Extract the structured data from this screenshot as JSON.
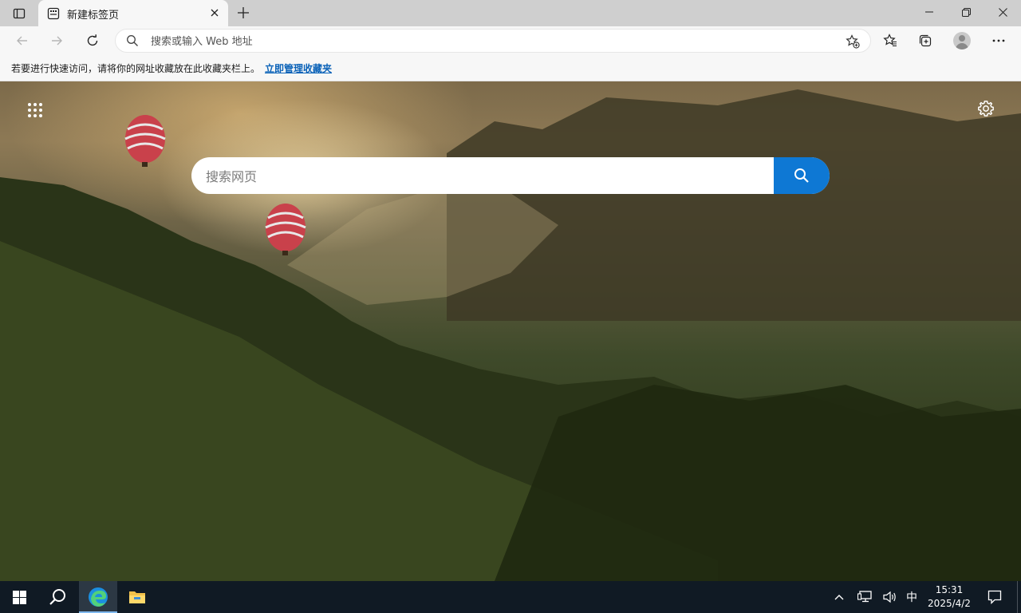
{
  "browser": {
    "tab": {
      "title": "新建标签页"
    },
    "omnibox": {
      "placeholder": "搜索或输入 Web 地址"
    },
    "favorites_bar": {
      "hint": "若要进行快速访问，请将你的网址收藏放在此收藏夹栏上。",
      "link": "立即管理收藏夹"
    }
  },
  "newtab": {
    "search": {
      "placeholder": "搜索网页"
    }
  },
  "taskbar": {
    "ime": "中",
    "time": "15:31",
    "date": "2025/4/2"
  },
  "colors": {
    "accent": "#0e78d4",
    "link": "#0a62b8",
    "taskbar": "#101a24"
  },
  "icons": [
    "tab-actions-icon",
    "new-tab-page-icon",
    "close-icon",
    "plus-icon",
    "minimize-icon",
    "restore-icon",
    "back-icon",
    "forward-icon",
    "refresh-icon",
    "search-icon",
    "add-favorite-icon",
    "favorites-icon",
    "collections-icon",
    "profile-icon",
    "more-icon",
    "app-launcher-icon",
    "gear-icon",
    "windows-start-icon",
    "edge-icon",
    "file-explorer-icon",
    "chevron-up-icon",
    "network-icon",
    "volume-icon",
    "notification-icon"
  ]
}
